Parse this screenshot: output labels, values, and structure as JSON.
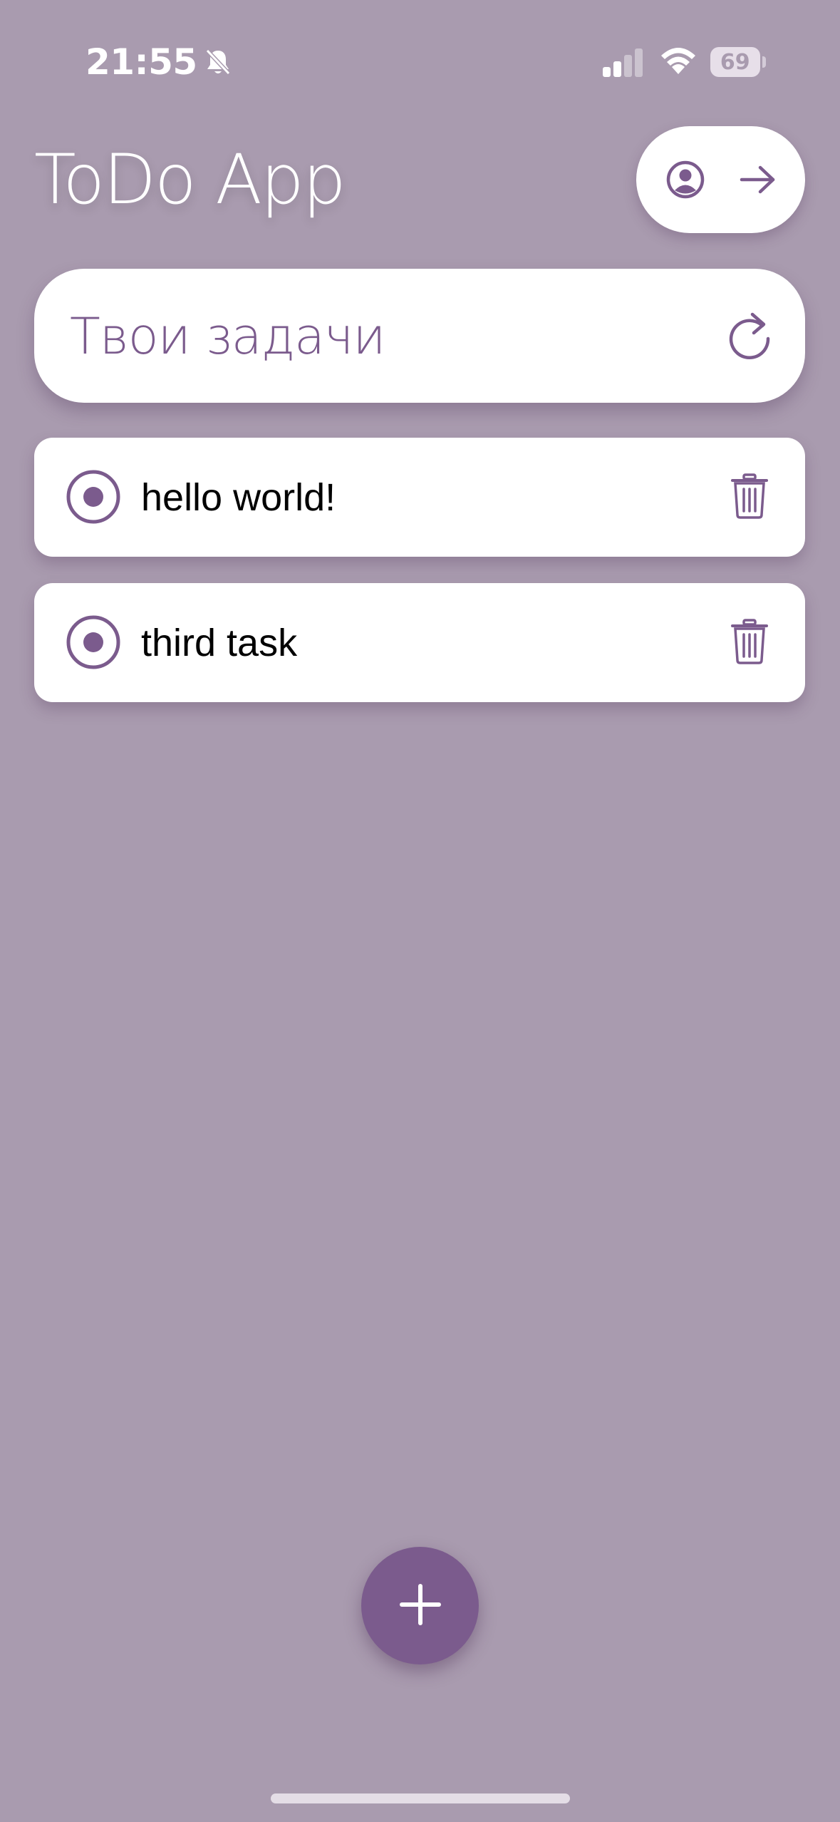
{
  "status_bar": {
    "time": "21:55",
    "battery_level": "69",
    "icons": [
      "bell-slash-icon",
      "cellular-signal-icon",
      "wifi-icon",
      "battery-icon"
    ]
  },
  "header": {
    "title": "ToDo App",
    "actions": [
      "user-profile-icon",
      "arrow-right-icon"
    ]
  },
  "section": {
    "title": "Твои задачи",
    "action_icon": "refresh-icon"
  },
  "tasks": [
    {
      "text": "hello world!",
      "status_icon": "radio-selected-icon",
      "action_icon": "trash-icon"
    },
    {
      "text": "third task",
      "status_icon": "radio-selected-icon",
      "action_icon": "trash-icon"
    }
  ],
  "fab": {
    "icon": "plus-icon"
  },
  "colors": {
    "background": "#a99baf",
    "accent": "#7b5b8d",
    "card": "#ffffff",
    "text": "#000000"
  }
}
